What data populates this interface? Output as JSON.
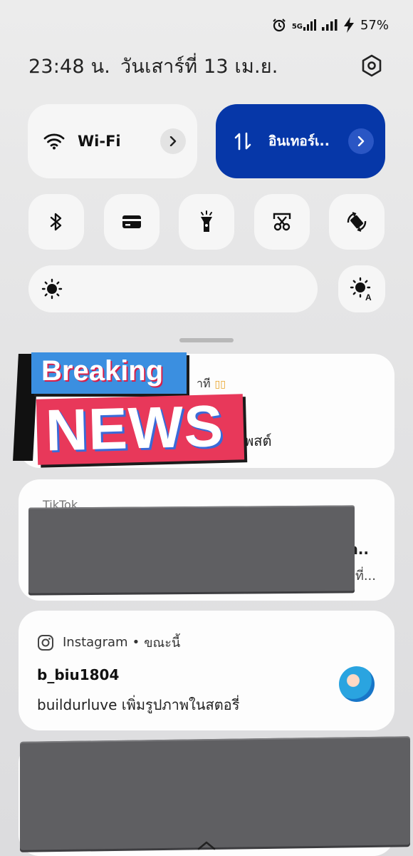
{
  "status_bar": {
    "network_label": "5G",
    "battery": "57%",
    "icons": [
      "alarm-icon",
      "signal-5g-icon",
      "signal-icon",
      "charging-icon"
    ]
  },
  "header": {
    "time": "23:48 น.",
    "date": "วันเสาร์ที่ 13 เม.ย.",
    "settings_icon": "settings-hex-icon"
  },
  "quick_tiles": {
    "wifi": {
      "label": "Wi-Fi",
      "icon": "wifi-icon",
      "active": false
    },
    "mobile_data": {
      "label": "อินเทอร์เ..",
      "icon": "data-arrows-icon",
      "active": true,
      "color": "#0637a8"
    },
    "toggles": [
      {
        "name": "bluetooth",
        "icon": "bluetooth-icon"
      },
      {
        "name": "card",
        "icon": "card-icon"
      },
      {
        "name": "flashlight",
        "icon": "flashlight-icon"
      },
      {
        "name": "screenshot",
        "icon": "scissors-icon"
      },
      {
        "name": "auto-rotate",
        "icon": "rotate-icon"
      }
    ],
    "brightness_icon": "sun-icon",
    "auto_brightness_icon": "sun-auto-icon"
  },
  "notifications": [
    {
      "id": "news",
      "overlay": {
        "top": "Breaking",
        "bottom": "NEWS"
      },
      "partial_app": "าที",
      "partial_badge": "▯▯",
      "partial_text": ".โพสต์"
    },
    {
      "id": "redacted-1",
      "partial_head": "TikTok",
      "partial_title": "n..",
      "partial_body": "ที่..."
    },
    {
      "id": "instagram",
      "app": "Instagram",
      "when": "ขณะนี้",
      "separator": "•",
      "user": "b_biu1804",
      "message": "buildurluve เพิ่มรูปภาพในสตอรี่"
    },
    {
      "id": "redacted-2"
    }
  ]
}
